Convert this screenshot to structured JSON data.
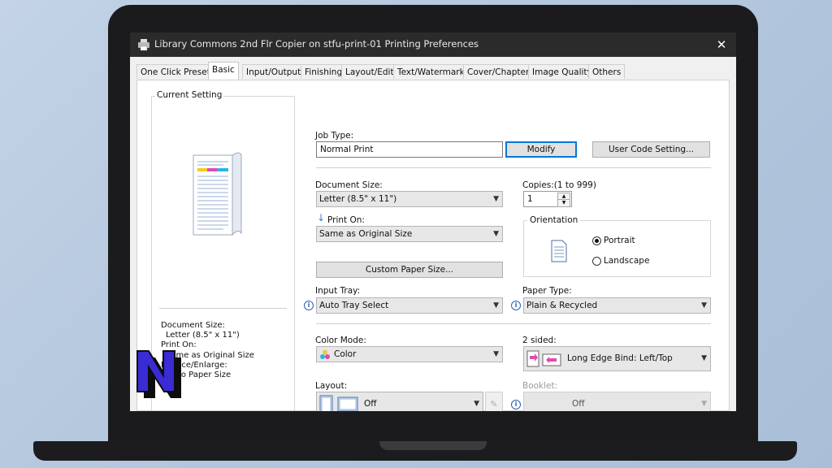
{
  "window": {
    "title": "Library Commons 2nd Flr Copier on stfu-print-01 Printing Preferences"
  },
  "tabs": [
    "One Click Presets",
    "Basic",
    "Input/Output",
    "Finishing",
    "Layout/Edit",
    "Text/Watermark",
    "Cover/Chapter",
    "Image Quality",
    "Others"
  ],
  "active_tab": "Basic",
  "current_setting": {
    "heading": "Current Setting",
    "lines": [
      "Document Size:",
      "Letter (8.5\" x 11\")",
      "Print On:",
      "Same as Original Size",
      "Reduce/Enlarge:",
      "Fit to Paper Size"
    ]
  },
  "job_type": {
    "label": "Job Type:",
    "value": "Normal Print",
    "modify_label": "Modify",
    "user_code_label": "User Code Setting..."
  },
  "document_size": {
    "label": "Document Size:",
    "value": "Letter (8.5\" x 11\")"
  },
  "copies": {
    "label": "Copies:(1 to 999)",
    "value": "1"
  },
  "print_on": {
    "label": "Print On:",
    "value": "Same as Original Size"
  },
  "orientation": {
    "label": "Orientation",
    "portrait": "Portrait",
    "landscape": "Landscape",
    "selected": "Portrait"
  },
  "custom_paper_label": "Custom Paper Size...",
  "input_tray": {
    "label": "Input Tray:",
    "value": "Auto Tray Select"
  },
  "paper_type": {
    "label": "Paper Type:",
    "value": "Plain & Recycled"
  },
  "color_mode": {
    "label": "Color Mode:",
    "value": "Color"
  },
  "two_sided": {
    "label": "2 sided:",
    "value": "Long Edge Bind: Left/Top"
  },
  "layout": {
    "label": "Layout:",
    "value": "Off"
  },
  "booklet": {
    "label": "Booklet:",
    "value": "Off"
  },
  "colors": {
    "accent": "#0078d7",
    "titlebar": "#2b2b2b",
    "logo": "#3a2bd4"
  }
}
